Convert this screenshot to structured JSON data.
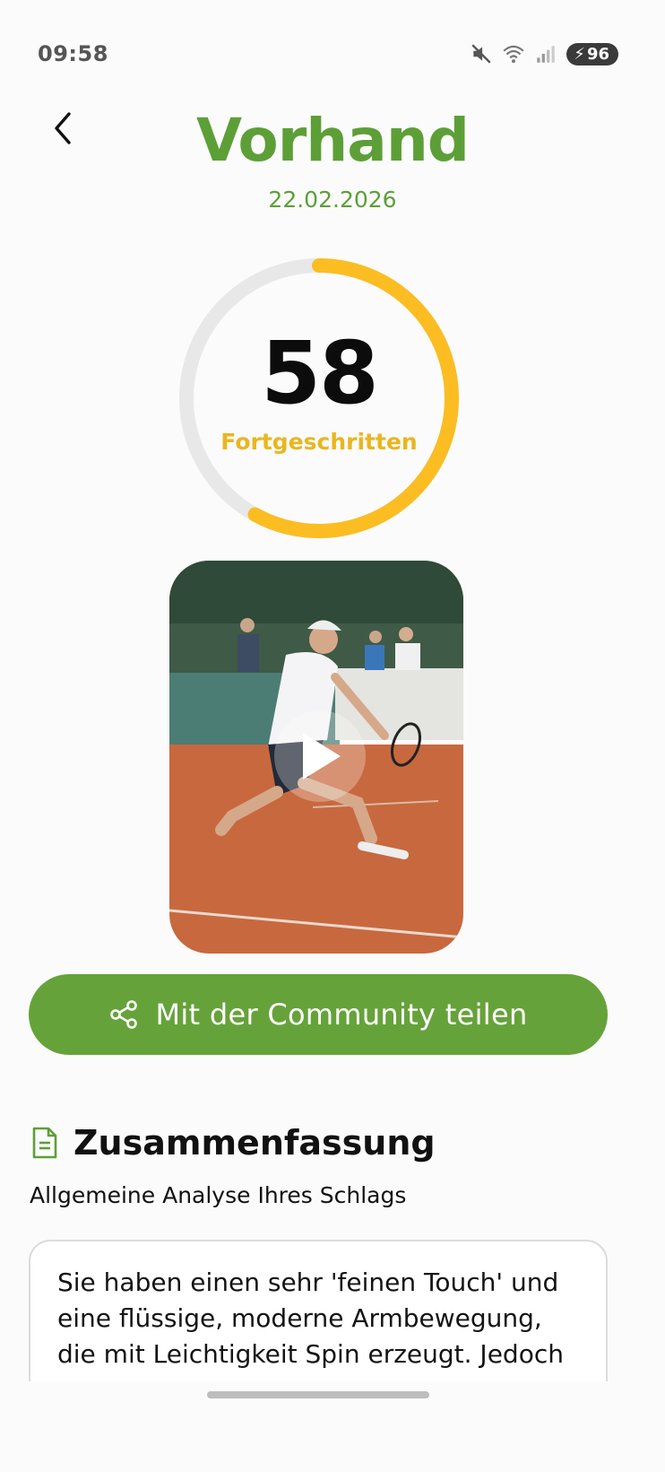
{
  "status_bar": {
    "time": "09:58",
    "battery": "96"
  },
  "header": {
    "title": "Vorhand",
    "date": "22.02.2026"
  },
  "score": {
    "value": "58",
    "level": "Fortgeschritten",
    "progress": 0.58,
    "ring_color": "#fbbd22",
    "track_color": "#e8e8e8"
  },
  "video": {
    "play_icon": "play-icon"
  },
  "share": {
    "label": "Mit der Community teilen",
    "icon": "share-icon"
  },
  "summary": {
    "title": "Zusammenfassung",
    "subtitle": "Allgemeine Analyse Ihres Schlags",
    "text": "Sie haben einen sehr 'feinen Touch' und eine flüssige, moderne Armbewegung, die mit Leichtigkeit Spin erzeugt. Jedoch"
  },
  "colors": {
    "brand_green": "#66a23a",
    "title_green": "#5d9f37",
    "accent_yellow": "#eab51f"
  }
}
